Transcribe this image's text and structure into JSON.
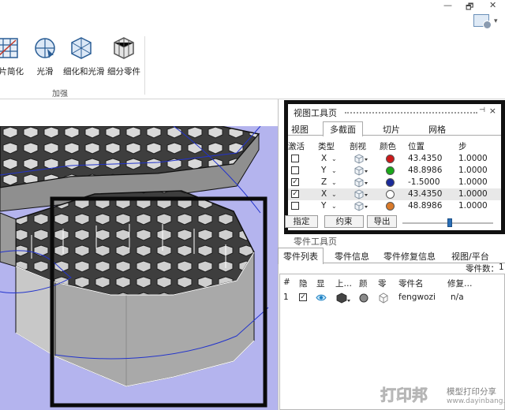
{
  "window": {
    "minimize_glyph": "—",
    "maximize_glyph": "🗗",
    "close_glyph": "✕",
    "help_icon": "help-gear-icon",
    "help_arrow": "▾"
  },
  "ribbon": {
    "buttons": [
      {
        "label": "面片简化",
        "icon": "mesh-simplify-icon"
      },
      {
        "label": "光滑",
        "icon": "smooth-icon"
      },
      {
        "label": "细化和光滑",
        "icon": "refine-smooth-icon"
      },
      {
        "label": "细分零件",
        "icon": "subdivide-part-icon"
      }
    ],
    "group_label": "加强"
  },
  "view_toolbox": {
    "title": "视图工具页",
    "pin_glyph": "⊣",
    "close_glyph": "×",
    "tabs": [
      "视图",
      "多截面",
      "切片",
      "网格"
    ],
    "active_tab": "多截面",
    "columns": [
      "激活",
      "类型",
      "剖视",
      "颜色",
      "位置",
      "步"
    ],
    "rows": [
      {
        "active": false,
        "axis": "X",
        "color": "#cc1a1a",
        "position": "43.4350",
        "step": "1.0000"
      },
      {
        "active": false,
        "axis": "Y",
        "color": "#1aa81a",
        "position": "48.8986",
        "step": "1.0000"
      },
      {
        "active": true,
        "axis": "Z",
        "color": "#1a2a99",
        "position": "-1.5000",
        "step": "1.0000"
      },
      {
        "active": true,
        "axis": "X",
        "color": "#ffffff",
        "position": "43.4350",
        "step": "1.0000"
      },
      {
        "active": false,
        "axis": "Y",
        "color": "#d97a2a",
        "position": "48.8986",
        "step": "1.0000"
      }
    ],
    "dropdown_glyph": "⌄",
    "buttons": [
      "指定",
      "约束",
      "导出"
    ]
  },
  "part_toolbox": {
    "title": "零件工具页",
    "tabs": [
      "零件列表",
      "零件信息",
      "零件修复信息",
      "视图/平台"
    ],
    "active_tab": "零件列表",
    "count_label": "零件数：",
    "count": "1",
    "columns": [
      "#",
      "隐",
      "显",
      "上…",
      "颜",
      "零",
      "零件名",
      "修复…"
    ],
    "rows": [
      {
        "index": "1",
        "checked": true,
        "name": "fengwozi",
        "repair": "n/a"
      }
    ]
  },
  "watermark": {
    "logo": "打印邦",
    "text": "模型打印分享",
    "url": "www.dayinbang.com"
  },
  "colors": {
    "viewport_bg": "#b4b4ee",
    "panel_border": "#111111",
    "accent": "#2a6db5"
  }
}
